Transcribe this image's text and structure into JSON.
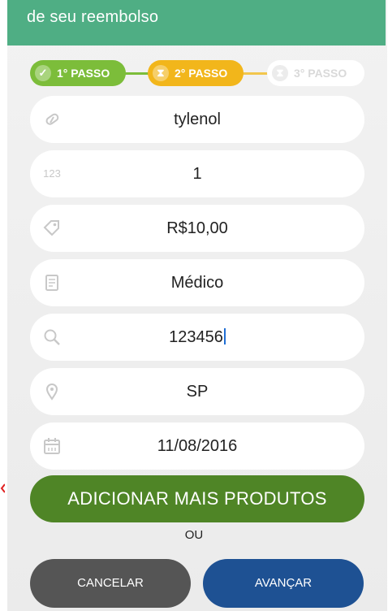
{
  "header": {
    "title": "de seu reembolso"
  },
  "steps": [
    {
      "label": "1° PASSO",
      "icon": "check-icon",
      "status": "done",
      "color": "#7cbd3a"
    },
    {
      "label": "2° PASSO",
      "icon": "hourglass-icon",
      "status": "current",
      "color": "#f2b61b"
    },
    {
      "label": "3° PASSO",
      "icon": "hourglass-icon",
      "status": "pending",
      "color": "#ffffff"
    }
  ],
  "form": {
    "product": {
      "icon": "pill-icon",
      "value": "tylenol"
    },
    "quantity": {
      "icon_text": "123",
      "value": "1"
    },
    "price": {
      "icon": "tag-icon",
      "value": "R$10,00"
    },
    "type": {
      "icon": "receipt-icon",
      "value": "Médico"
    },
    "code": {
      "icon": "search-icon",
      "value": "123456"
    },
    "state": {
      "icon": "location-pin-icon",
      "value": "SP"
    },
    "date": {
      "icon": "calendar-icon",
      "value": "11/08/2016"
    }
  },
  "actions": {
    "add_more": "ADICIONAR MAIS PRODUTOS",
    "or_text": "OU",
    "cancel": "CANCELAR",
    "next": "AVANÇAR"
  },
  "colors": {
    "header": "#4fae84",
    "add_button": "#4f8526",
    "cancel_button": "#555555",
    "next_button": "#1e5193"
  }
}
